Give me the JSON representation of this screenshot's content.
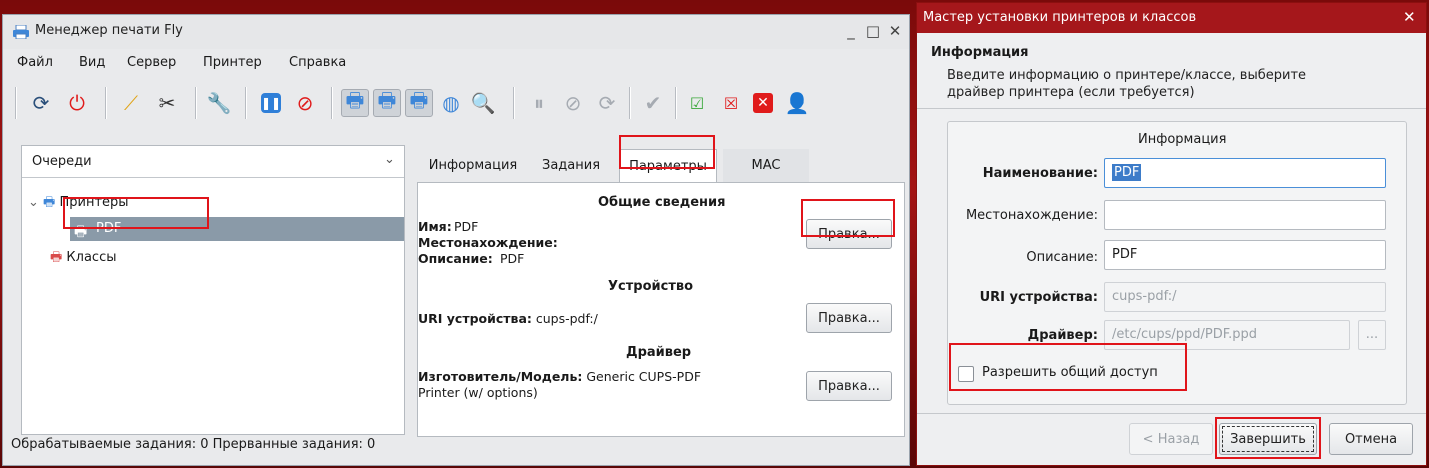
{
  "print_manager": {
    "title": "Менеджер печати Fly",
    "menu": [
      "Файл",
      "Вид",
      "Сервер",
      "Принтер",
      "Справка"
    ],
    "queues_combo": "Очереди",
    "tree": {
      "printers": "Принтеры",
      "pdf": "PDF",
      "classes": "Классы"
    },
    "tabs": [
      "Информация",
      "Задания",
      "Параметры",
      "MAC"
    ],
    "params": {
      "general_header": "Общие сведения",
      "name_label": "Имя:",
      "name_value": "PDF",
      "location_label": "Местонахождение:",
      "description_label": "Описание:",
      "description_value": "PDF",
      "device_header": "Устройство",
      "uri_label": "URI устройства:",
      "uri_value": "cups-pdf:/",
      "driver_header": "Драйвер",
      "model_label": "Изготовитель/Модель:",
      "model_value_1": "Generic CUPS-PDF",
      "model_value_2": "Printer (w/ options)",
      "edit_button": "Правка..."
    },
    "status": "Обрабатываемые задания: 0 Прерванные задания: 0"
  },
  "wizard": {
    "title": "Мастер установки принтеров и классов",
    "heading": "Информация",
    "desc_line1": "Введите информацию о принтере/классе, выберите",
    "desc_line2": "драйвер принтера (если требуется)",
    "group_title": "Информация",
    "name_label": "Наименование:",
    "name_value": "PDF",
    "location_label": "Местонахождение:",
    "location_value": "",
    "description_label": "Описание:",
    "description_value": "PDF",
    "uri_label": "URI устройства:",
    "uri_value": "cups-pdf:/",
    "driver_label": "Драйвер:",
    "driver_value": "/etc/cups/ppd/PDF.ppd",
    "browse_label": "...",
    "share_label": "Разрешить общий доступ",
    "back_button": "< Назад",
    "finish_button": "Завершить",
    "cancel_button": "Отмена"
  },
  "colors": {
    "accent_red": "#e0141a",
    "wizard_titlebar": "#a5171b",
    "selection": "#8a9aa8",
    "focus_blue": "#4a8fd8"
  }
}
